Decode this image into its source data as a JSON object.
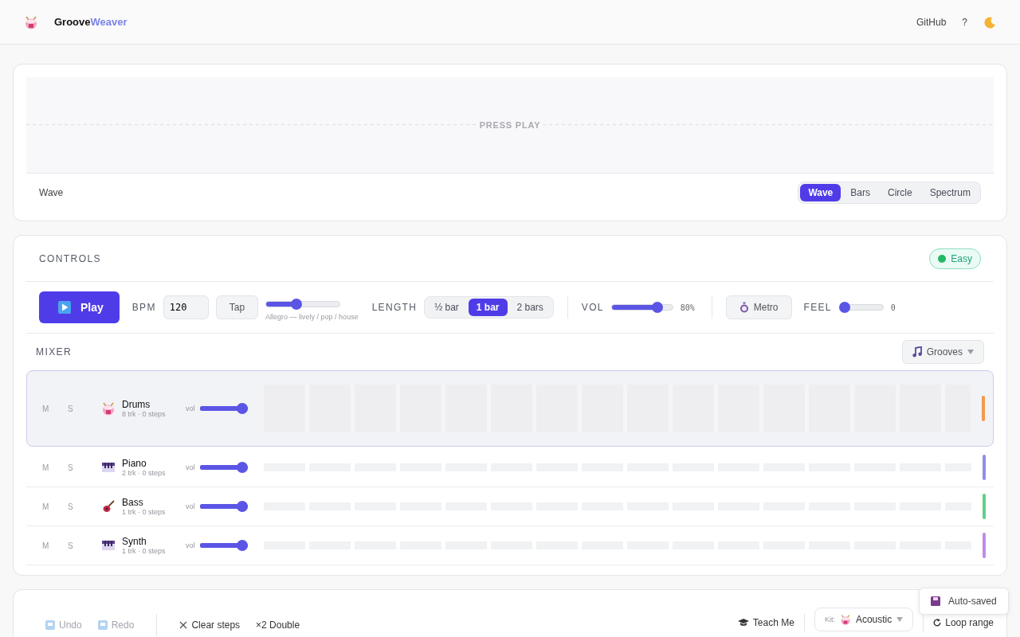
{
  "header": {
    "brand": "Groove",
    "brand_accent": "Weaver",
    "links": [
      {
        "label": "GitHub"
      },
      {
        "label": "?"
      }
    ]
  },
  "visualizer": {
    "placeholder": "PRESS PLAY",
    "mode_label": "Wave",
    "modes": [
      {
        "label": "Wave",
        "selected": true
      },
      {
        "label": "Bars",
        "selected": false
      },
      {
        "label": "Circle",
        "selected": false
      },
      {
        "label": "Spectrum",
        "selected": false
      }
    ]
  },
  "controls": {
    "title": "CONTROLS",
    "difficulty": "Easy",
    "play": "Play",
    "bpm_label": "BPM",
    "bpm": "120",
    "tap": "Tap",
    "tempo": {
      "level": 0.4,
      "hint": "Allegro — lively / pop / house"
    },
    "length": {
      "label": "LENGTH",
      "options": [
        {
          "label": "½ bar",
          "selected": false
        },
        {
          "label": "1 bar",
          "selected": true
        },
        {
          "label": "2 bars",
          "selected": false
        }
      ]
    },
    "volume": {
      "label": "VOL",
      "level": 0.8,
      "reading": "80%"
    },
    "metro": "Metro",
    "feel": {
      "label": "FEEL",
      "level": 0,
      "reading": "0"
    }
  },
  "mixer": {
    "title": "MIXER",
    "grooves": "Grooves",
    "tracks": [
      {
        "kind": "drum",
        "name": "Drums",
        "info": "8 trk · 0 steps",
        "mute": "M",
        "solo": "S",
        "vol_label": "vol",
        "level": 1,
        "selected": true,
        "color": "#f39a4c"
      },
      {
        "kind": "piano",
        "name": "Piano",
        "info": "2 trk · 0 steps",
        "mute": "M",
        "solo": "S",
        "vol_label": "vol",
        "level": 1,
        "selected": false,
        "color": "#8d90e6"
      },
      {
        "kind": "guitar",
        "name": "Bass",
        "info": "1 trk · 0 steps",
        "mute": "M",
        "solo": "S",
        "vol_label": "vol",
        "level": 1,
        "selected": false,
        "color": "#5fd08b"
      },
      {
        "kind": "piano",
        "name": "Synth",
        "info": "1 trk · 0 steps",
        "mute": "M",
        "solo": "S",
        "vol_label": "vol",
        "level": 1,
        "selected": false,
        "color": "#c38ae8"
      }
    ]
  },
  "toolbar": {
    "left": [
      {
        "kind": "undo",
        "label": "Undo",
        "disabled": true
      },
      {
        "kind": "redo",
        "label": "Redo",
        "disabled": true
      },
      {
        "kind": "clear",
        "label": "Clear steps",
        "disabled": false
      },
      {
        "kind": "double",
        "label": "×2 Double",
        "disabled": false
      }
    ],
    "teach": "Teach Me",
    "kit_label": "Kit:",
    "kit": "Acoustic",
    "loop": "Loop range"
  },
  "toast": "Auto-saved"
}
